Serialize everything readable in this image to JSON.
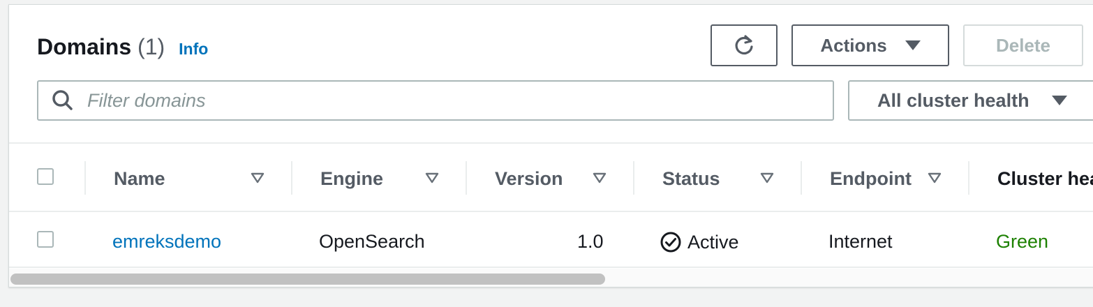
{
  "header": {
    "title": "Domains",
    "count": "(1)",
    "info_label": "Info"
  },
  "toolbar": {
    "refresh_icon": "refresh-icon",
    "actions_label": "Actions",
    "delete_label": "Delete"
  },
  "filter": {
    "placeholder": "Filter domains",
    "health_select": "All cluster health"
  },
  "table": {
    "columns": [
      "Name",
      "Engine",
      "Version",
      "Status",
      "Endpoint",
      "Cluster hea"
    ],
    "rows": [
      {
        "name": "emreksdemo",
        "engine": "OpenSearch",
        "version": "1.0",
        "status": "Active",
        "endpoint": "Internet",
        "cluster_health": "Green"
      }
    ]
  },
  "colors": {
    "link": "#0073bb",
    "health_green": "#1d8102",
    "button_border": "#545b64",
    "disabled": "#aab7b8"
  }
}
